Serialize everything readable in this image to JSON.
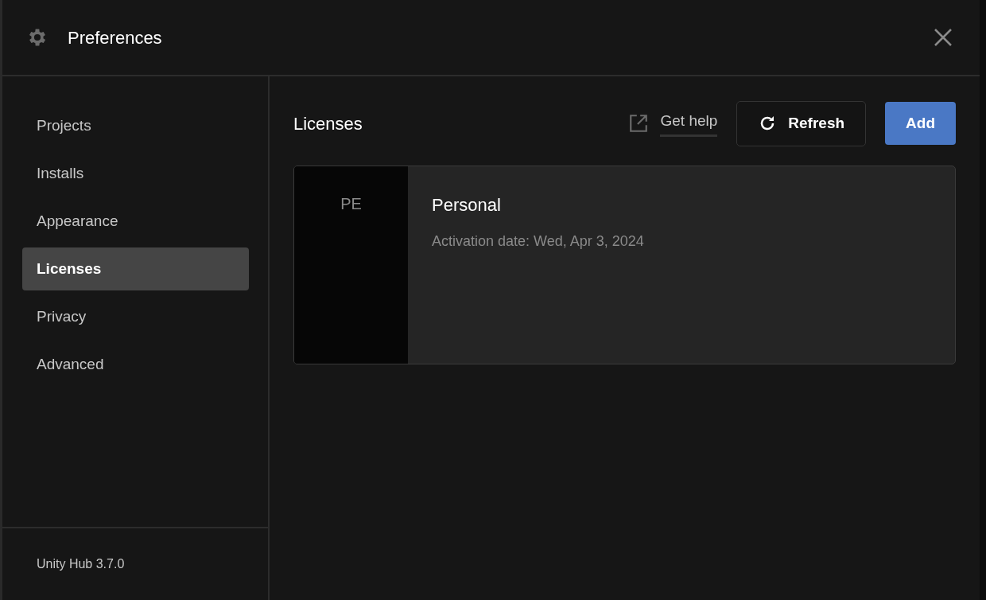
{
  "window": {
    "title": "Preferences"
  },
  "sidebar": {
    "items": [
      {
        "label": "Projects",
        "selected": false
      },
      {
        "label": "Installs",
        "selected": false
      },
      {
        "label": "Appearance",
        "selected": false
      },
      {
        "label": "Licenses",
        "selected": true
      },
      {
        "label": "Privacy",
        "selected": false
      },
      {
        "label": "Advanced",
        "selected": false
      }
    ],
    "footer": "Unity Hub 3.7.0"
  },
  "content": {
    "heading": "Licenses",
    "help_link": "Get help",
    "buttons": [
      {
        "label": "Refresh",
        "kind": "outline"
      },
      {
        "label": "Add",
        "kind": "primary"
      }
    ],
    "licenses": [
      {
        "initials": "PE",
        "name": "Personal",
        "detail": "Activation date: Wed, Apr 3, 2024"
      }
    ]
  }
}
